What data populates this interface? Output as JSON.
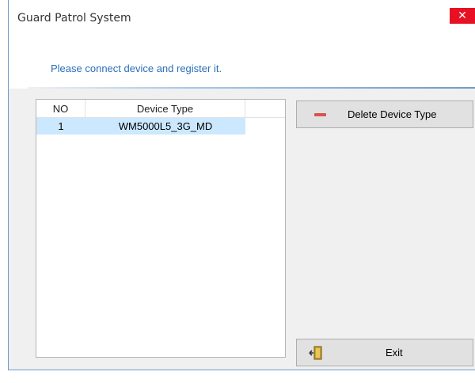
{
  "window": {
    "title": "Guard Patrol System",
    "close_glyph": "✕"
  },
  "banner": {
    "message": "Please connect device and register it."
  },
  "device_list": {
    "columns": [
      "NO",
      "Device Type"
    ],
    "rows": [
      {
        "no": "1",
        "device_type": "WM5000L5_3G_MD",
        "selected": true
      }
    ]
  },
  "buttons": {
    "delete_label": "Delete Device Type",
    "delete_icon": "minus-icon",
    "exit_label": "Exit",
    "exit_icon": "exit-door-icon"
  },
  "colors": {
    "accent_blue": "#2a6fb8",
    "selection": "#cce8ff",
    "close_red": "#e81123",
    "minus_red": "#d9534f"
  }
}
